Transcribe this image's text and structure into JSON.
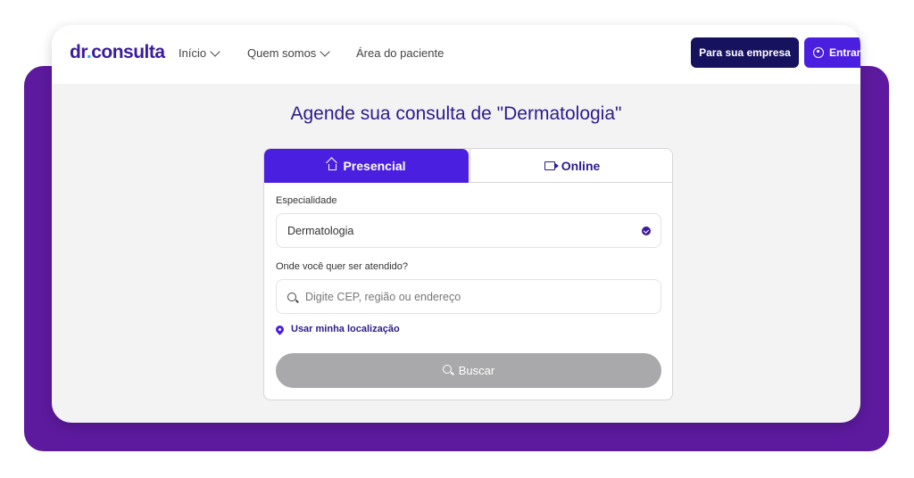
{
  "header": {
    "logo_prefix": "dr",
    "logo_dot": ".",
    "logo_suffix": "consulta",
    "nav": [
      {
        "label": "Início"
      },
      {
        "label": "Quem somos"
      },
      {
        "label": "Área do paciente"
      }
    ],
    "company_button": "Para sua empresa",
    "login_button": "Entrar"
  },
  "main": {
    "title": "Agende sua consulta de \"Dermatologia\"",
    "tabs": [
      {
        "label": "Presencial",
        "icon": "house-icon",
        "active": true
      },
      {
        "label": "Online",
        "icon": "video-icon",
        "active": false
      }
    ],
    "specialty": {
      "label": "Especialidade",
      "value": "Dermatologia"
    },
    "location": {
      "label": "Onde você quer ser atendido?",
      "placeholder": "Digite CEP, região ou endereço"
    },
    "use_location_link": "Usar minha localização",
    "search_button": "Buscar"
  },
  "colors": {
    "brand_purple": "#4b1fe0",
    "dark_navy": "#17125e",
    "backdrop_purple": "#5d1a9e",
    "title_color": "#2e1a8c",
    "disabled_button": "#a9a9ab"
  }
}
